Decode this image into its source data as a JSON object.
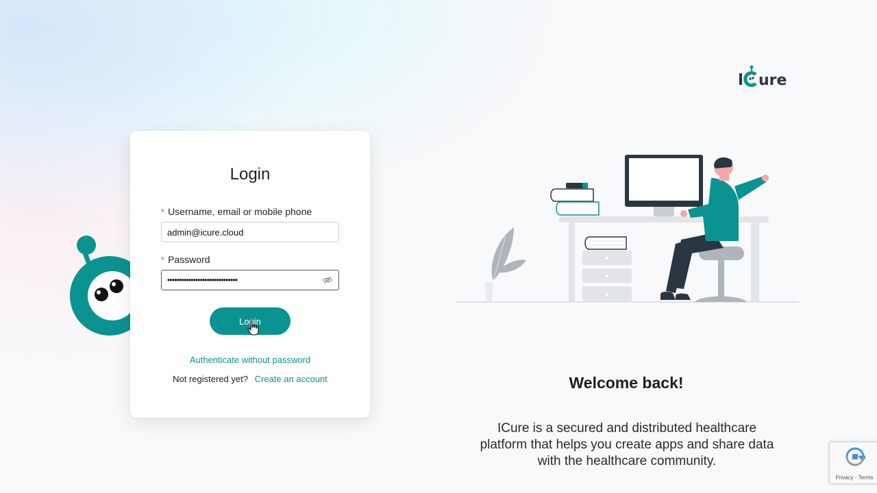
{
  "brand": {
    "name": "iCure",
    "accent_color": "#0a9391",
    "dark_color": "#2a3642"
  },
  "login_card": {
    "title": "Login",
    "username": {
      "required_marker": "*",
      "label": "Username, email or mobile phone",
      "value": "admin@icure.cloud"
    },
    "password": {
      "required_marker": "*",
      "label": "Password",
      "masked_value": "••••••••••••••••••••••••••••••",
      "toggle_icon": "eye-slash-icon"
    },
    "login_button": "Login",
    "authenticate_link": "Authenticate without password",
    "register_prompt": "Not registered yet?",
    "create_account_link": "Create an account"
  },
  "welcome": {
    "heading": "Welcome back!",
    "description": "ICure is a secured and distributed healthcare platform that helps you create apps and share data with the healthcare community."
  },
  "recaptcha": {
    "links": "Privacy - Terms"
  }
}
